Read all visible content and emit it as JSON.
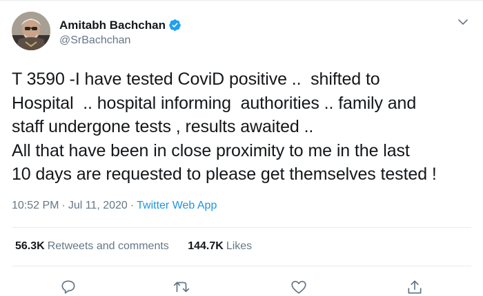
{
  "author": {
    "display_name": "Amitabh Bachchan",
    "handle": "@SrBachchan",
    "verified": true,
    "avatar_icon": "profile-photo"
  },
  "tweet": {
    "text": "T 3590 -I have tested CoviD positive ..  shifted to\nHospital  .. hospital informing  authorities .. family and\nstaff undergone tests , results awaited ..\nAll that have been in close proximity to me in the last\n10 days are requested to please get themselves tested !",
    "time": "10:52 PM",
    "separator": "·",
    "date": "Jul 11, 2020",
    "source": "Twitter Web App"
  },
  "stats": {
    "retweets_count": "56.3K",
    "retweets_label": "Retweets and comments",
    "likes_count": "144.7K",
    "likes_label": "Likes"
  },
  "actions": {
    "icons": [
      "reply-icon",
      "retweet-icon",
      "like-icon",
      "share-icon"
    ]
  },
  "colors": {
    "text": "#14171a",
    "secondary": "#657786",
    "link": "#1b95e0",
    "verified": "#1da1f2",
    "divider": "#e6ecf0"
  }
}
